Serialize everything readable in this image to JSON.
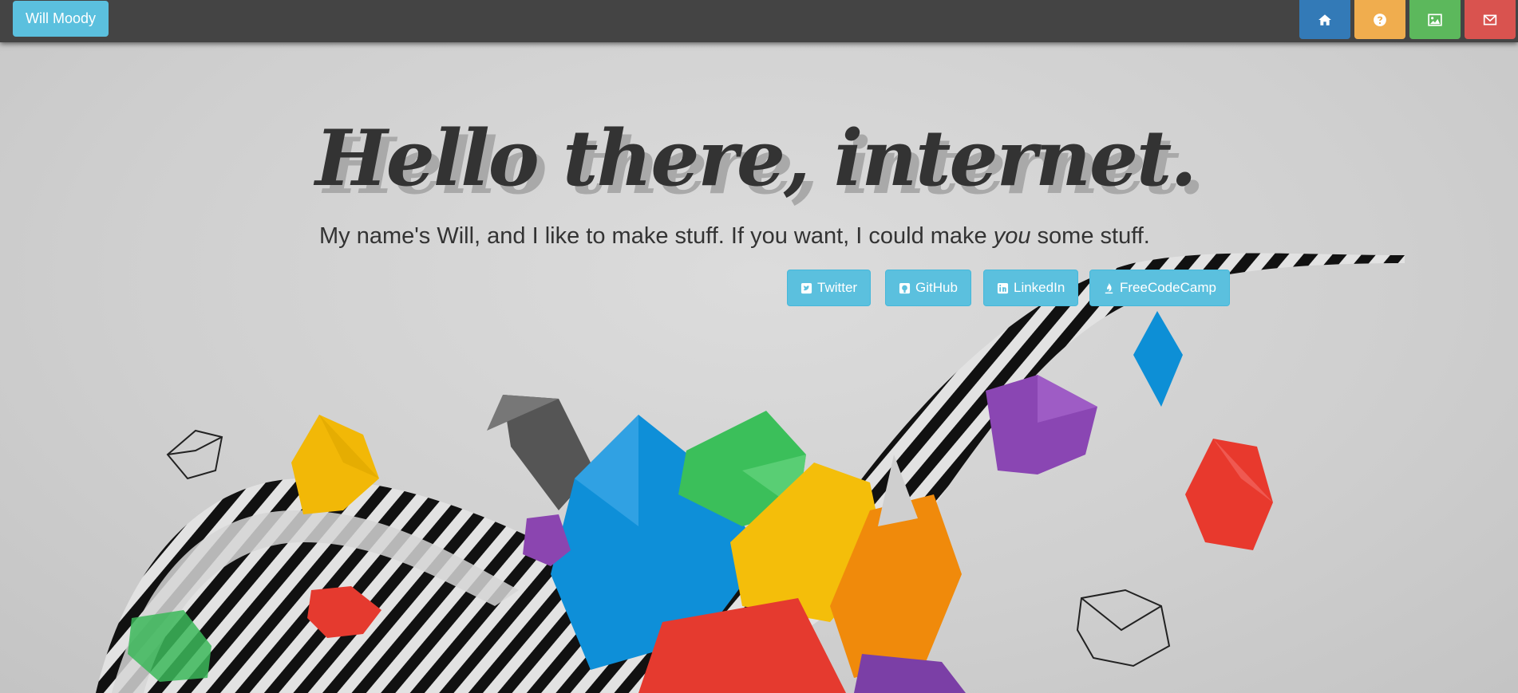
{
  "navbar": {
    "brand": "Will Moody",
    "buttons": [
      {
        "icon": "home-icon",
        "color": "#337ab7"
      },
      {
        "icon": "question-circle-icon",
        "color": "#f0ad4e"
      },
      {
        "icon": "image-icon",
        "color": "#5cb85c"
      },
      {
        "icon": "envelope-icon",
        "color": "#d9534f"
      }
    ]
  },
  "hero": {
    "headline": "Hello there, internet.",
    "tagline_before": "My name's Will, and I like to make stuff. If you want, I could make ",
    "tagline_emphasis": "you",
    "tagline_after": " some stuff."
  },
  "social": [
    {
      "label": "Twitter",
      "icon": "twitter-icon"
    },
    {
      "label": "GitHub",
      "icon": "github-icon"
    },
    {
      "label": "LinkedIn",
      "icon": "linkedin-icon"
    },
    {
      "label": "FreeCodeCamp",
      "icon": "fire-icon"
    }
  ],
  "colors": {
    "accent": "#5bc0de",
    "navbar": "#444444",
    "text": "#333333"
  }
}
